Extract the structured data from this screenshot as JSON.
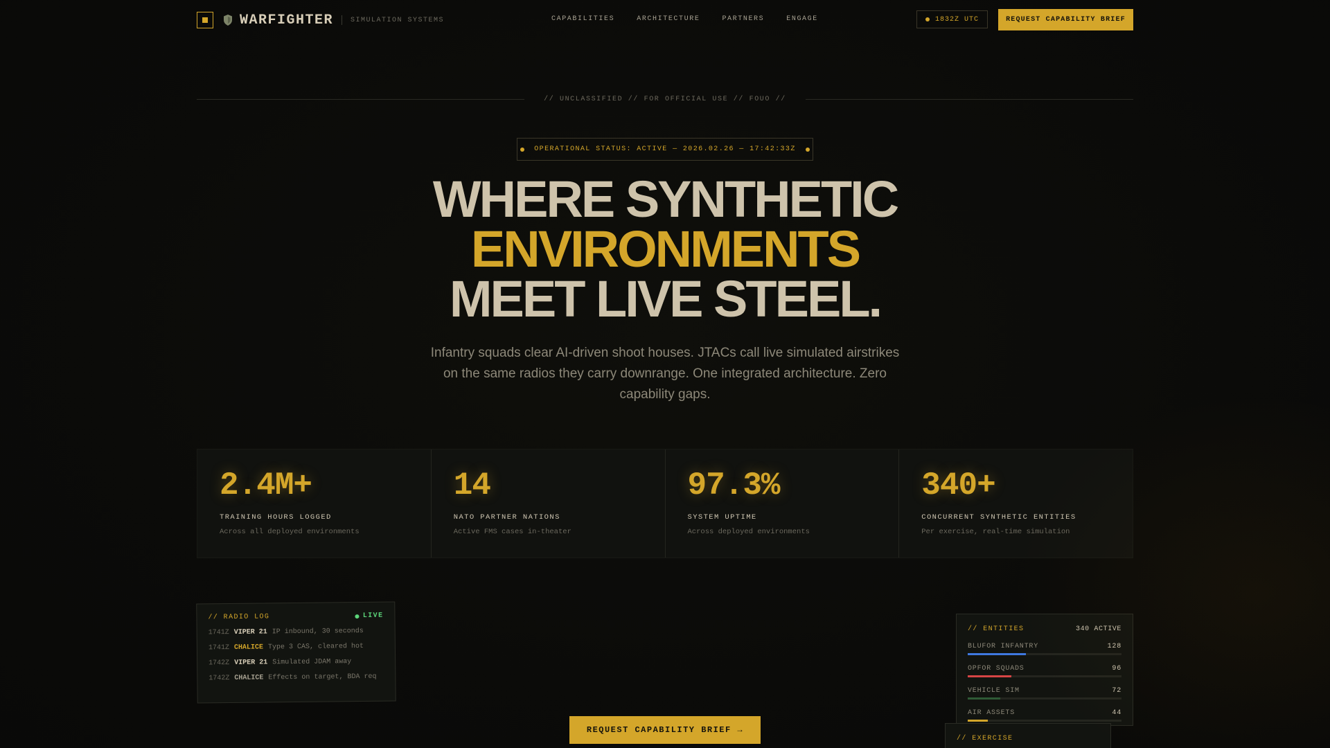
{
  "nav": {
    "brand": "WARFIGHTER",
    "subtitle": "SIMULATION SYSTEMS",
    "links": [
      "CAPABILITIES",
      "ARCHITECTURE",
      "PARTNERS",
      "ENGAGE"
    ],
    "utc_label": "1832Z UTC",
    "cta_label": "REQUEST CAPABILITY BRIEF"
  },
  "classification": "// UNCLASSIFIED // FOR OFFICIAL USE // FOUO //",
  "status": "OPERATIONAL STATUS: ACTIVE — 2026.02.26 — 17:42:33Z",
  "hero": {
    "line1": "WHERE SYNTHETIC",
    "line2": "ENVIRONMENTS",
    "line3": "MEET LIVE STEEL.",
    "subtext": "Infantry squads clear AI-driven shoot houses. JTACs call live simulated airstrikes on the same radios they carry downrange. One integrated architecture. Zero capability gaps."
  },
  "stats": [
    {
      "value": "2.4M+",
      "label": "TRAINING HOURS LOGGED",
      "desc": "Across all deployed environments"
    },
    {
      "value": "14",
      "label": "NATO PARTNER NATIONS",
      "desc": "Active FMS cases in-theater"
    },
    {
      "value": "97.3%",
      "label": "SYSTEM UPTIME",
      "desc": "Across deployed environments"
    },
    {
      "value": "340+",
      "label": "CONCURRENT SYNTHETIC ENTITIES",
      "desc": "Per exercise, real-time simulation"
    }
  ],
  "radio_log": {
    "title": "// RADIO LOG",
    "live": "LIVE",
    "entries": [
      {
        "time": "1741Z",
        "callsign": "VIPER 21",
        "message": "IP inbound, 30 seconds",
        "color": "#d8ceb8"
      },
      {
        "time": "1741Z",
        "callsign": "CHALICE",
        "message": "Type 3 CAS, cleared hot",
        "color": "#d4a62a"
      },
      {
        "time": "1742Z",
        "callsign": "VIPER 21",
        "message": "Simulated JDAM away",
        "color": "#d8ceb8"
      },
      {
        "time": "1742Z",
        "callsign": "CHALICE",
        "message": "Effects on target, BDA req",
        "color": "#a8a292"
      }
    ]
  },
  "entities": {
    "title": "// ENTITIES",
    "count": "340 ACTIVE",
    "total": 340,
    "items": [
      {
        "label": "BLUFOR INFANTRY",
        "count": "128",
        "value": 128,
        "color": "#3f78e0"
      },
      {
        "label": "OPFOR SQUADS",
        "count": "96",
        "value": 96,
        "color": "#d64545"
      },
      {
        "label": "VEHICLE SIM",
        "count": "72",
        "value": 72,
        "color": "#2e5a35"
      },
      {
        "label": "AIR ASSETS",
        "count": "44",
        "value": 44,
        "color": "#d4a62a"
      }
    ]
  },
  "exercise": {
    "title": "// EXERCISE"
  },
  "cta_bottom": "REQUEST CAPABILITY BRIEF →",
  "colors": {
    "accent": "#d4a62a",
    "live": "#5cd67a"
  }
}
